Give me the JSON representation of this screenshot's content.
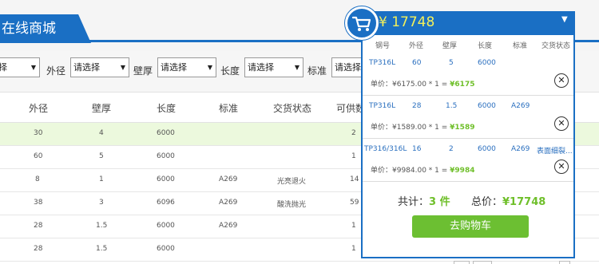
{
  "header": {
    "title": "在线商城"
  },
  "filters": {
    "first_value": "择",
    "outer_label": "外径",
    "outer_value": "请选择",
    "wall_label": "壁厚",
    "wall_value": "请选择",
    "length_label": "长度",
    "length_value": "请选择",
    "standard_label": "标准",
    "standard_value": "请选择"
  },
  "table": {
    "headers": [
      "外径",
      "壁厚",
      "长度",
      "标准",
      "交货状态",
      "可供数"
    ],
    "rows": [
      [
        "30",
        "4",
        "6000",
        "",
        "",
        "2"
      ],
      [
        "60",
        "5",
        "6000",
        "",
        "",
        "1"
      ],
      [
        "8",
        "1",
        "6000",
        "A269",
        "光亮退火",
        "14"
      ],
      [
        "38",
        "3",
        "6096",
        "A269",
        "酸洗抛光",
        "59"
      ],
      [
        "28",
        "1.5",
        "6000",
        "A269",
        "",
        "1"
      ],
      [
        "28",
        "1.5",
        "6000",
        "",
        "",
        "1"
      ]
    ]
  },
  "cart": {
    "total_header": "¥ 17748",
    "headers": [
      "钢号",
      "外径",
      "壁厚",
      "长度",
      "标准",
      "交货状态"
    ],
    "items": [
      {
        "grade": "TP316L",
        "outer": "60",
        "wall": "5",
        "length": "6000",
        "standard": "",
        "status": "",
        "price_line": "单价：¥6175.00 * 1 = ",
        "subtotal": "¥6175"
      },
      {
        "grade": "TP316L",
        "outer": "28",
        "wall": "1.5",
        "length": "6000",
        "standard": "A269",
        "status": "",
        "price_line": "单价：¥1589.00 * 1 = ",
        "subtotal": "¥1589"
      },
      {
        "grade": "TP316/316L",
        "outer": "16",
        "wall": "2",
        "length": "6000",
        "standard": "A269",
        "status": "表面细裂...",
        "price_line": "单价：¥9984.00 * 1 = ",
        "subtotal": "¥9984"
      }
    ],
    "count_label": "共计：",
    "count_value": "3 件",
    "total_label": "总价：",
    "total_value": "¥17748",
    "button_label": "去购物车"
  },
  "colors": {
    "primary": "#1a6fc4",
    "accent_green": "#6cbf32",
    "price_yellow": "#f3f05a",
    "row_highlight": "#ecf9dd"
  }
}
